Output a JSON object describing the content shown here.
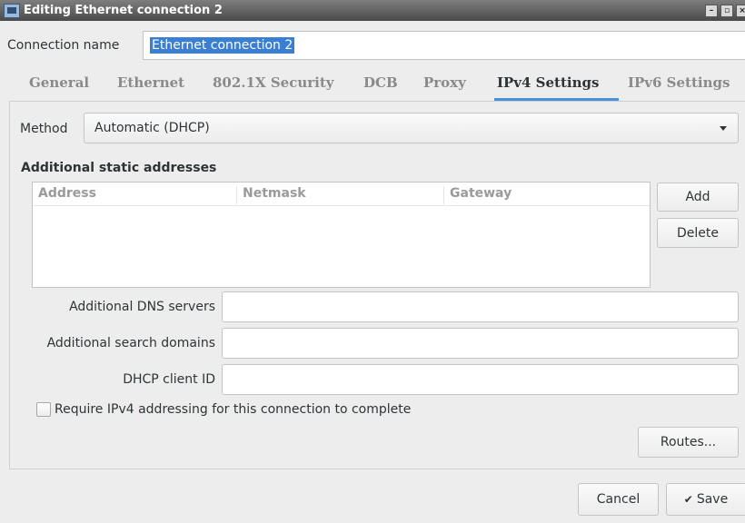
{
  "window": {
    "title": "Editing Ethernet connection 2",
    "controls": [
      "–",
      "▫",
      "×"
    ]
  },
  "connection": {
    "label": "Connection name",
    "value": "Ethernet connection 2"
  },
  "tabs": [
    {
      "label": "General",
      "active": false
    },
    {
      "label": "Ethernet",
      "active": false
    },
    {
      "label": "802.1X Security",
      "active": false
    },
    {
      "label": "DCB",
      "active": false
    },
    {
      "label": "Proxy",
      "active": false
    },
    {
      "label": "IPv4 Settings",
      "active": true
    },
    {
      "label": "IPv6 Settings",
      "active": false
    }
  ],
  "method": {
    "label": "Method",
    "value": "Automatic (DHCP)"
  },
  "addresses": {
    "title": "Additional static addresses",
    "columns": [
      "Address",
      "Netmask",
      "Gateway"
    ],
    "rows": [],
    "add_label": "Add",
    "delete_label": "Delete"
  },
  "dns": {
    "label": "Additional DNS servers",
    "value": ""
  },
  "search_domains": {
    "label": "Additional search domains",
    "value": ""
  },
  "dhcp_client_id": {
    "label": "DHCP client ID",
    "value": ""
  },
  "require_ipv4": {
    "label": "Require IPv4 addressing for this connection to complete",
    "checked": false
  },
  "routes_label": "Routes...",
  "footer": {
    "cancel_label": "Cancel",
    "save_label": "Save"
  },
  "colors": {
    "accent": "#4a90d9",
    "selection": "#3b7fd4"
  }
}
